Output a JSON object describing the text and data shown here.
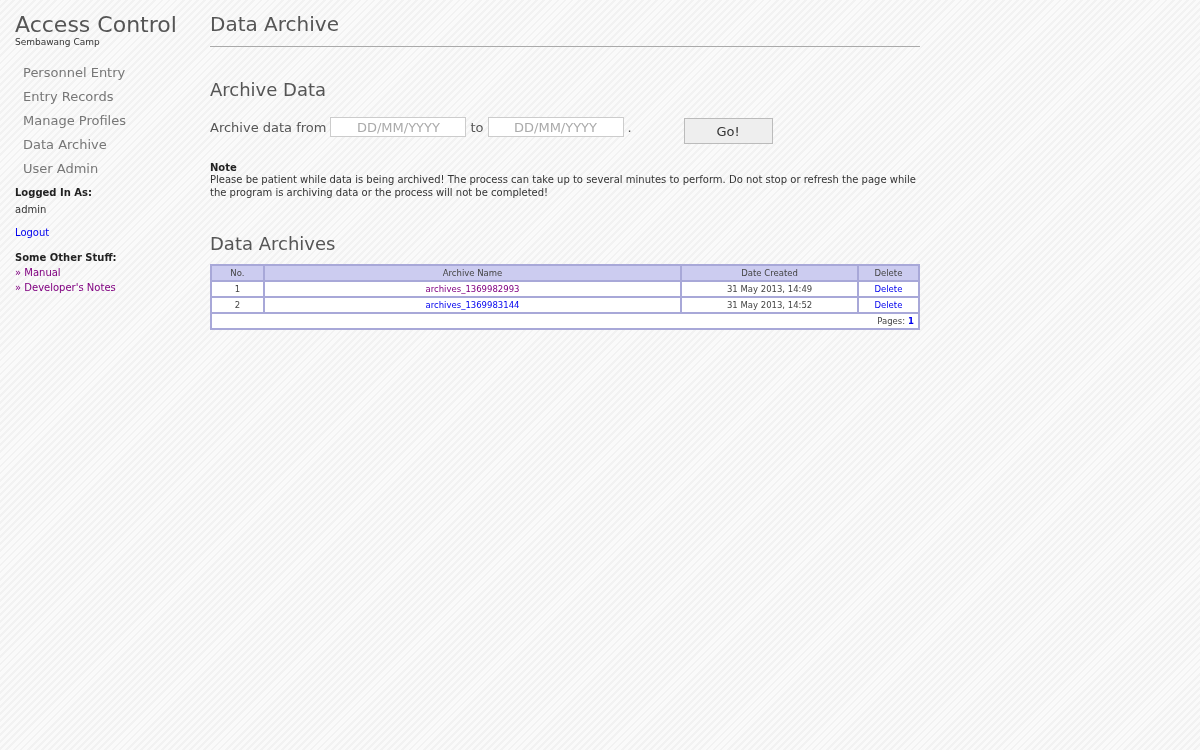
{
  "brand": {
    "title": "Access Control",
    "subtitle": "Sembawang Camp"
  },
  "nav": [
    {
      "label": "Personnel Entry"
    },
    {
      "label": "Entry Records"
    },
    {
      "label": "Manage Profiles"
    },
    {
      "label": "Data Archive"
    },
    {
      "label": "User Admin"
    }
  ],
  "login": {
    "heading": "Logged In As:",
    "user": "admin",
    "logout": "Logout"
  },
  "other": {
    "heading": "Some Other Stuff:",
    "links": [
      {
        "label": "» Manual",
        "visited": true
      },
      {
        "label": "» Developer's Notes",
        "visited": true
      }
    ]
  },
  "page_title": "Data Archive",
  "archive_form": {
    "heading": "Archive Data",
    "label_from": "Archive data from",
    "from_placeholder": "DD/MM/YYYY",
    "label_to": "to",
    "to_placeholder": "DD/MM/YYYY",
    "end": ".",
    "button": "Go!"
  },
  "note": {
    "heading": "Note",
    "text": "Please be patient while data is being archived! The process can take up to several minutes to perform. Do not stop or refresh the page while the program is archiving data or the process will not be completed!"
  },
  "archives": {
    "heading": "Data Archives",
    "columns": [
      "No.",
      "Archive Name",
      "Date Created",
      "Delete"
    ],
    "rows": [
      {
        "no": "1",
        "name": "archives_1369982993",
        "visited": true,
        "date": "31 May 2013, 14:49",
        "action": "Delete"
      },
      {
        "no": "2",
        "name": "archives_1369983144",
        "visited": false,
        "date": "31 May 2013, 14:52",
        "action": "Delete"
      }
    ],
    "pages_label": "Pages:",
    "pages": [
      "1"
    ]
  }
}
